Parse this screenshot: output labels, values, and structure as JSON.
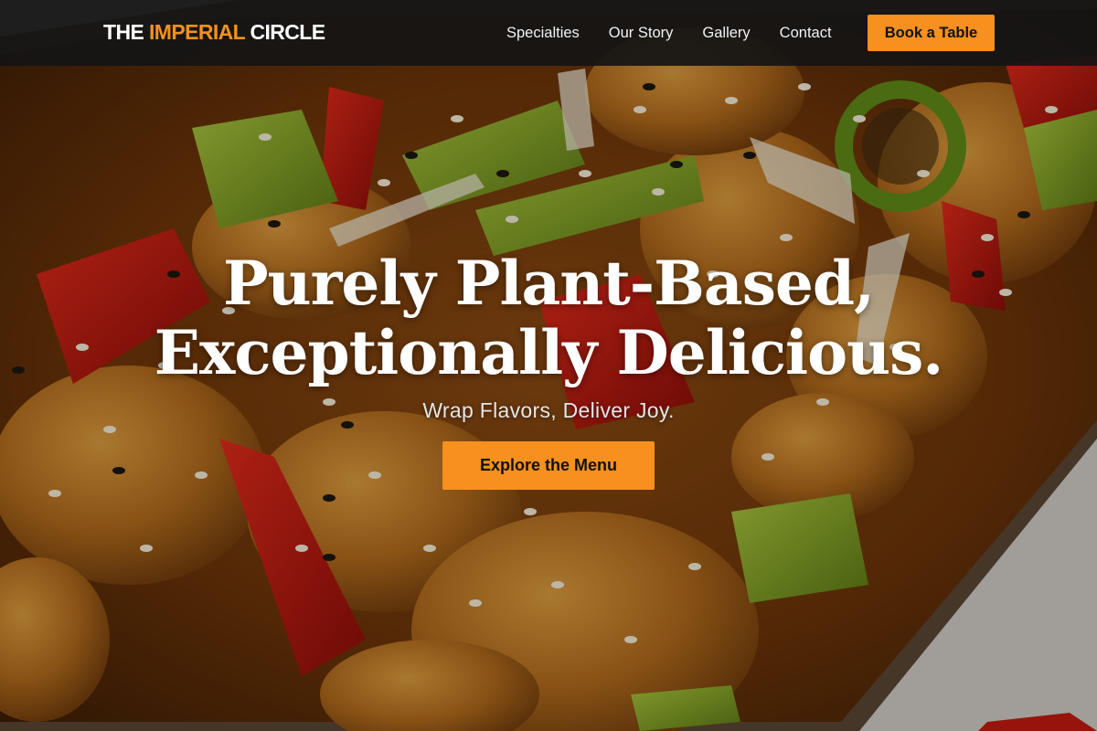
{
  "brand": {
    "part1": "THE ",
    "accent": "IMPERIAL",
    "part2": " CIRCLE",
    "accent_color": "#f7901e"
  },
  "nav": {
    "items": [
      {
        "label": "Specialties"
      },
      {
        "label": "Our Story"
      },
      {
        "label": "Gallery"
      },
      {
        "label": "Contact"
      }
    ],
    "cta_label": "Book a Table"
  },
  "hero": {
    "title_line1": "Purely Plant-Based,",
    "title_line2": "Exceptionally Delicious.",
    "subtitle": "Wrap Flavors, Deliver Joy.",
    "cta_label": "Explore the Menu",
    "background_image": "stir-fried sweet and sour dish with bell peppers and sesame seeds"
  },
  "colors": {
    "accent": "#f7901e",
    "header_bg": "#141414",
    "text_light": "#ffffff"
  }
}
